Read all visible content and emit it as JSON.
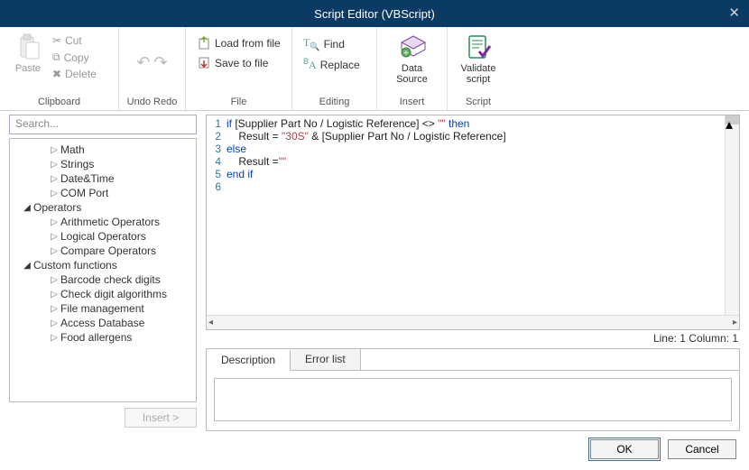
{
  "title": "Script Editor (VBScript)",
  "ribbon": {
    "clipboard": {
      "label": "Clipboard",
      "paste": "Paste",
      "cut": "Cut",
      "copy": "Copy",
      "delete": "Delete"
    },
    "undoredo": {
      "label": "Undo Redo"
    },
    "file": {
      "label": "File",
      "load": "Load from file",
      "save": "Save to file"
    },
    "editing": {
      "label": "Editing",
      "find": "Find",
      "replace": "Replace"
    },
    "insert": {
      "label": "Insert",
      "datasource": "Data Source"
    },
    "script": {
      "label": "Script",
      "validate_l1": "Validate",
      "validate_l2": "script"
    }
  },
  "search": {
    "placeholder": "Search..."
  },
  "tree": {
    "items": [
      {
        "label": "Math",
        "indent": 44,
        "expanded": false
      },
      {
        "label": "Strings",
        "indent": 44,
        "expanded": false
      },
      {
        "label": "Date&Time",
        "indent": 44,
        "expanded": false
      },
      {
        "label": "COM Port",
        "indent": 44,
        "expanded": false
      },
      {
        "label": "Operators",
        "indent": 14,
        "expanded": true
      },
      {
        "label": "Arithmetic Operators",
        "indent": 44,
        "expanded": false
      },
      {
        "label": "Logical Operators",
        "indent": 44,
        "expanded": false
      },
      {
        "label": "Compare Operators",
        "indent": 44,
        "expanded": false
      },
      {
        "label": "Custom functions",
        "indent": 14,
        "expanded": true
      },
      {
        "label": "Barcode check digits",
        "indent": 44,
        "expanded": false
      },
      {
        "label": "Check digit algorithms",
        "indent": 44,
        "expanded": false
      },
      {
        "label": "File management",
        "indent": 44,
        "expanded": false
      },
      {
        "label": "Access Database",
        "indent": 44,
        "expanded": false
      },
      {
        "label": "Food allergens",
        "indent": 44,
        "expanded": false
      }
    ]
  },
  "insert_btn": "Insert >",
  "code": {
    "lines": [
      "1",
      "2",
      "3",
      "4",
      "5",
      "6"
    ],
    "line1_kw": "if",
    "line1_mid": " [Supplier Part No / Logistic Reference] <> ",
    "line1_str": "\"\"",
    "line1_kw2": " then",
    "line2_a": "    Result = ",
    "line2_s": "\"30S\"",
    "line2_b": " & [Supplier Part No / Logistic Reference]",
    "line3": "else",
    "line4_a": "    Result =",
    "line4_s": "\"\"",
    "line5": "end if"
  },
  "status": "Line: 1 Column: 1",
  "tabs": {
    "desc": "Description",
    "err": "Error list"
  },
  "footer": {
    "ok": "OK",
    "cancel": "Cancel"
  }
}
